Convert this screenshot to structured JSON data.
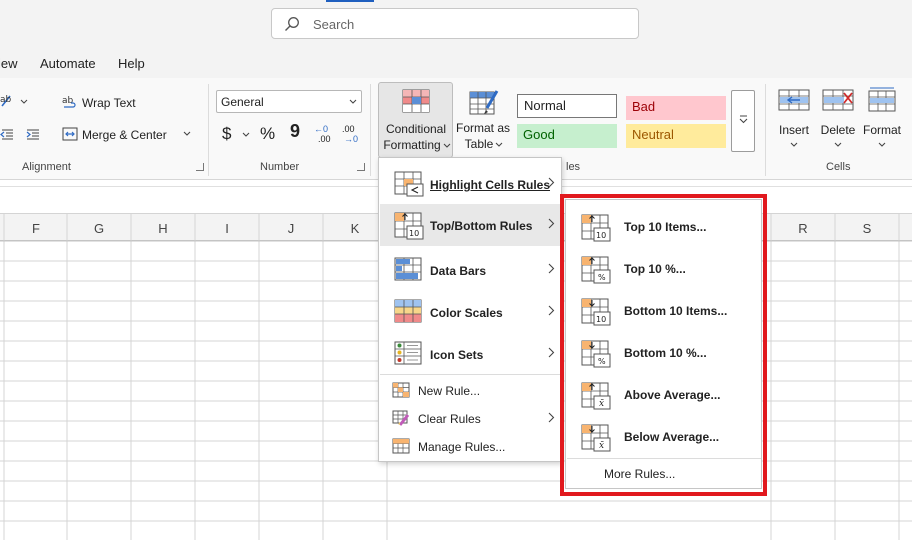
{
  "search": {
    "placeholder": "Search"
  },
  "menu_tabs": [
    "iew",
    "Automate",
    "Help"
  ],
  "ribbon": {
    "alignment": {
      "wrap_text": "Wrap Text",
      "merge_center": "Merge & Center",
      "label": "Alignment"
    },
    "number": {
      "format": "General",
      "label": "Number",
      "currency": "$",
      "percent": "%",
      "comma": "9",
      "inc": "←0",
      "inc_sub": ".00",
      "dec": ".00",
      "dec_sub": "→0"
    },
    "styles": {
      "cf_line1": "Conditional",
      "cf_line2": "Formatting",
      "fat_line1": "Format as",
      "fat_line2": "Table",
      "normal": "Normal",
      "bad": "Bad",
      "good": "Good",
      "neutral": "Neutral",
      "label_partial": "les"
    },
    "cells": {
      "insert": "Insert",
      "delete": "Delete",
      "format": "Format",
      "label": "Cells"
    }
  },
  "columns": [
    "F",
    "G",
    "H",
    "I",
    "J",
    "K",
    "R",
    "S"
  ],
  "cf_menu": {
    "items": [
      "Highlight Cells Rules",
      "Top/Bottom Rules",
      "Data Bars",
      "Color Scales",
      "Icon Sets"
    ],
    "small_items": [
      "New Rule...",
      "Clear Rules",
      "Manage Rules..."
    ]
  },
  "topbottom_menu": {
    "items": [
      "Top 10 Items...",
      "Top 10 %...",
      "Bottom 10 Items...",
      "Bottom 10 %...",
      "Above Average...",
      "Below Average..."
    ],
    "icon_badges": [
      "10",
      "%",
      "10",
      "%",
      "x̄",
      "x̄"
    ],
    "more": "More Rules..."
  },
  "colors": {
    "highlight_border": "#e1191e",
    "bad_fill": "#ffc7ce",
    "good_fill": "#c6efce",
    "neutral_fill": "#ffeb9c"
  }
}
